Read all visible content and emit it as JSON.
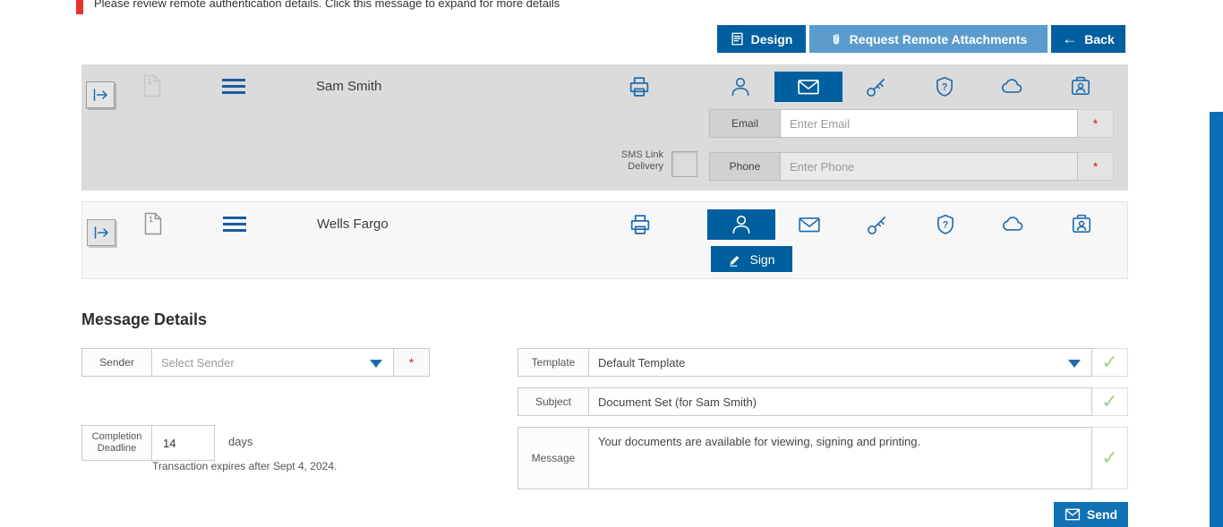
{
  "notice": {
    "text": "Please review remote authentication details. Click this message to expand for more details"
  },
  "toolbar": {
    "design_label": "Design",
    "request_remote_attachments_label": "Request Remote Attachments",
    "back_label": "Back",
    "back_arrow": "←"
  },
  "recipients": [
    {
      "name": "Sam Smith",
      "order": "1",
      "email": {
        "label": "Email",
        "placeholder": "Enter Email"
      },
      "sms": {
        "line1": "SMS Link",
        "line2": "Delivery"
      },
      "phone": {
        "label": "Phone",
        "placeholder": "Enter Phone"
      },
      "required_marker": "*"
    },
    {
      "name": "Wells Fargo",
      "order": "1",
      "sign_label": "Sign"
    }
  ],
  "message_details": {
    "heading": "Message Details",
    "sender": {
      "label": "Sender",
      "placeholder": "Select Sender",
      "required_marker": "*"
    },
    "template": {
      "label": "Template",
      "value": "Default Template"
    },
    "subject": {
      "label": "Subject",
      "value": "Document Set (for Sam Smith)"
    },
    "message": {
      "label": "Message",
      "value": "Your documents are available for viewing, signing and printing."
    },
    "deadline": {
      "label_line1": "Completion",
      "label_line2": "Deadline",
      "value": "14",
      "unit": "days",
      "note": "Transaction expires after Sept 4, 2024."
    },
    "send_label": "Send",
    "check_mark": "✓"
  },
  "icons": {
    "toolbar": [
      "document-design",
      "paperclip",
      "left-arrow"
    ],
    "row": [
      "move-recipient",
      "document-page",
      "menu-hamburger",
      "printer"
    ],
    "delivery_methods": [
      "person",
      "envelope",
      "key",
      "shield-question",
      "cloud",
      "contact-card"
    ],
    "sign": "pen",
    "send": "envelope"
  },
  "colors": {
    "primary_blue": "#005f9e",
    "light_blue_button": "#5b9bcd",
    "send_blue": "#1171b5",
    "icon_blue": "#1f6cad",
    "success_green": "#a9cd8f",
    "required_red": "#cc2222",
    "notice_red": "#e93131",
    "row_gray": "#dbdbdb",
    "right_strip_blue": "#0d6db4"
  }
}
